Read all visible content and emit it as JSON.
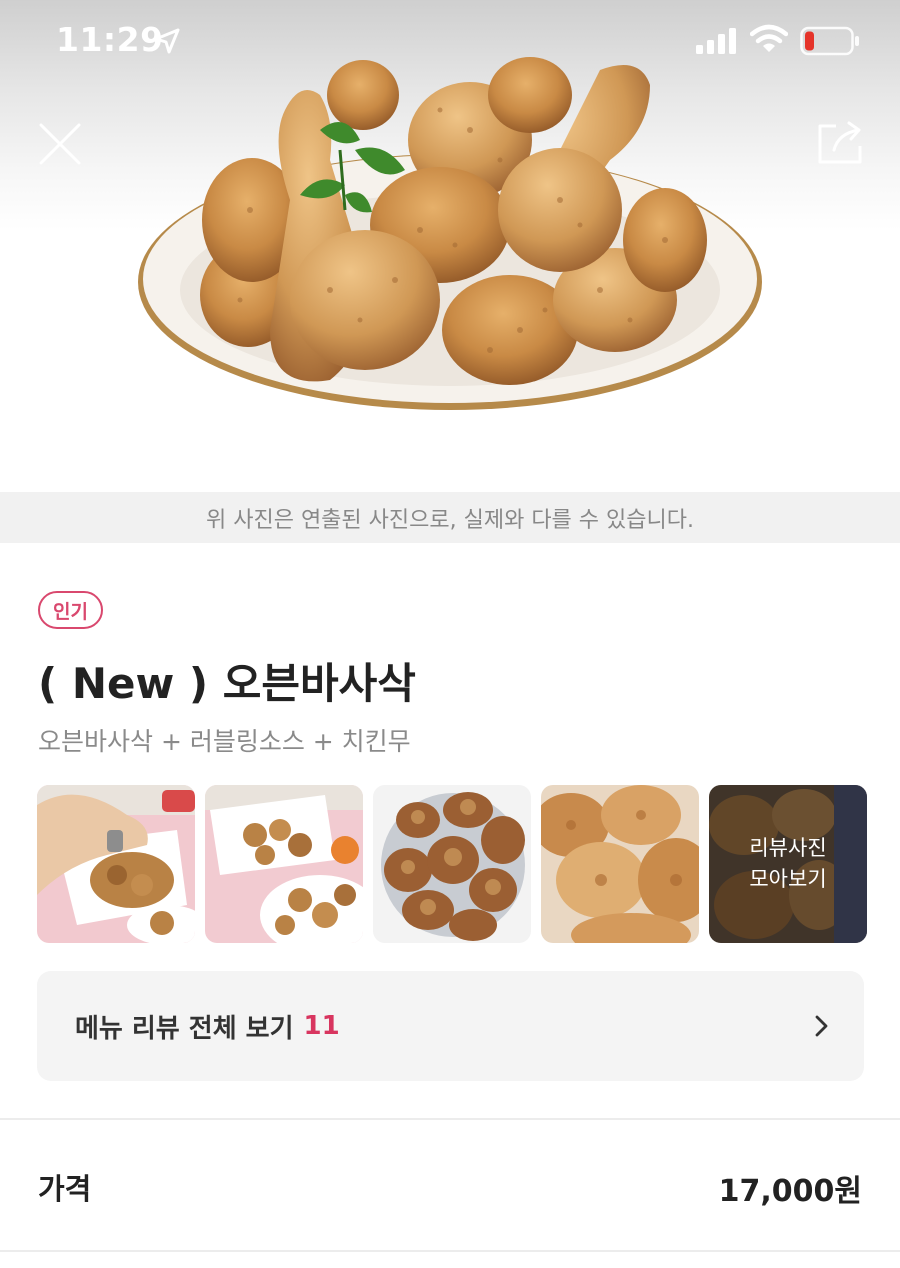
{
  "status_bar": {
    "time": "11:29",
    "location_icon": "location-arrow-icon",
    "signal_icon": "cellular-signal-icon",
    "wifi_icon": "wifi-icon",
    "battery_icon": "battery-low-icon",
    "battery_color": "#e5342a"
  },
  "header": {
    "close_icon": "close-icon",
    "share_icon": "share-icon"
  },
  "hero": {
    "image": "fried-chicken-plate",
    "disclaimer": "위 사진은 연출된 사진으로, 실제와 다를 수 있습니다."
  },
  "menu": {
    "badge": "인기",
    "badge_color": "#d9486e",
    "title": "( New ) 오븐바사삭",
    "description": "오븐바사삭 + 러블링소스 + 치킨무"
  },
  "review_photos": {
    "items": [
      {
        "image": "review-photo-1"
      },
      {
        "image": "review-photo-2"
      },
      {
        "image": "review-photo-3"
      },
      {
        "image": "review-photo-4"
      }
    ],
    "more_label": "리뷰사진\n모아보기"
  },
  "reviews_button": {
    "label": "메뉴 리뷰 전체 보기",
    "count": "11",
    "count_color": "#d8355f",
    "chevron_icon": "chevron-right-icon"
  },
  "price": {
    "label": "가격",
    "value": "17,000원"
  }
}
